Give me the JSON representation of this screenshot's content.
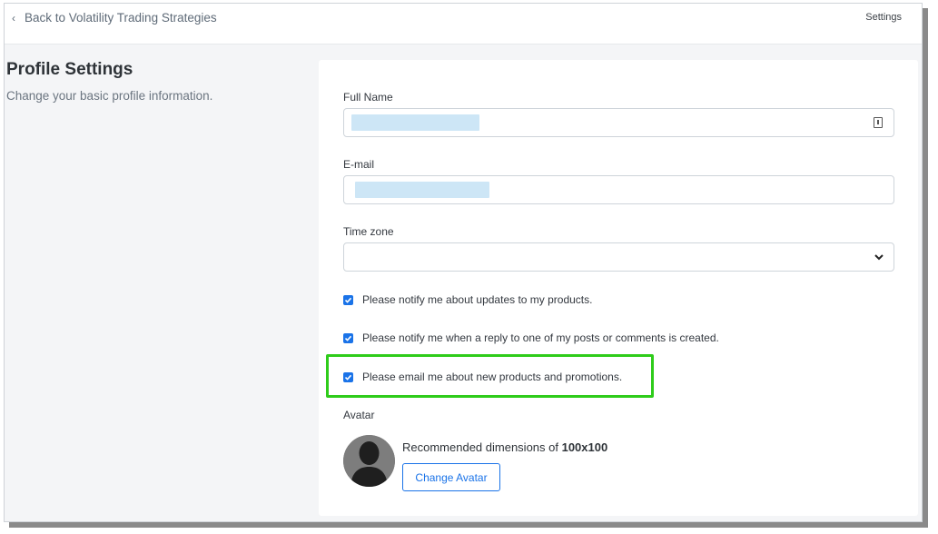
{
  "topbar": {
    "back_label": "Back to Volatility Trading Strategies",
    "settings_label": "Settings"
  },
  "left": {
    "title": "Profile Settings",
    "subtitle": "Change your basic profile information."
  },
  "form": {
    "full_name_label": "Full Name",
    "email_label": "E-mail",
    "timezone_label": "Time zone",
    "notify_updates": "Please notify me about updates to my products.",
    "notify_replies": "Please notify me when a reply to one of my posts or comments is created.",
    "email_promotions": "Please email me about new products and promotions.",
    "avatar_label": "Avatar",
    "recommended_prefix": "Recommended dimensions of ",
    "recommended_size": "100x100",
    "change_avatar_label": "Change Avatar"
  },
  "colors": {
    "accent": "#1a73e8",
    "highlight": "#2ecc1a",
    "masked": "#cde6f6"
  }
}
